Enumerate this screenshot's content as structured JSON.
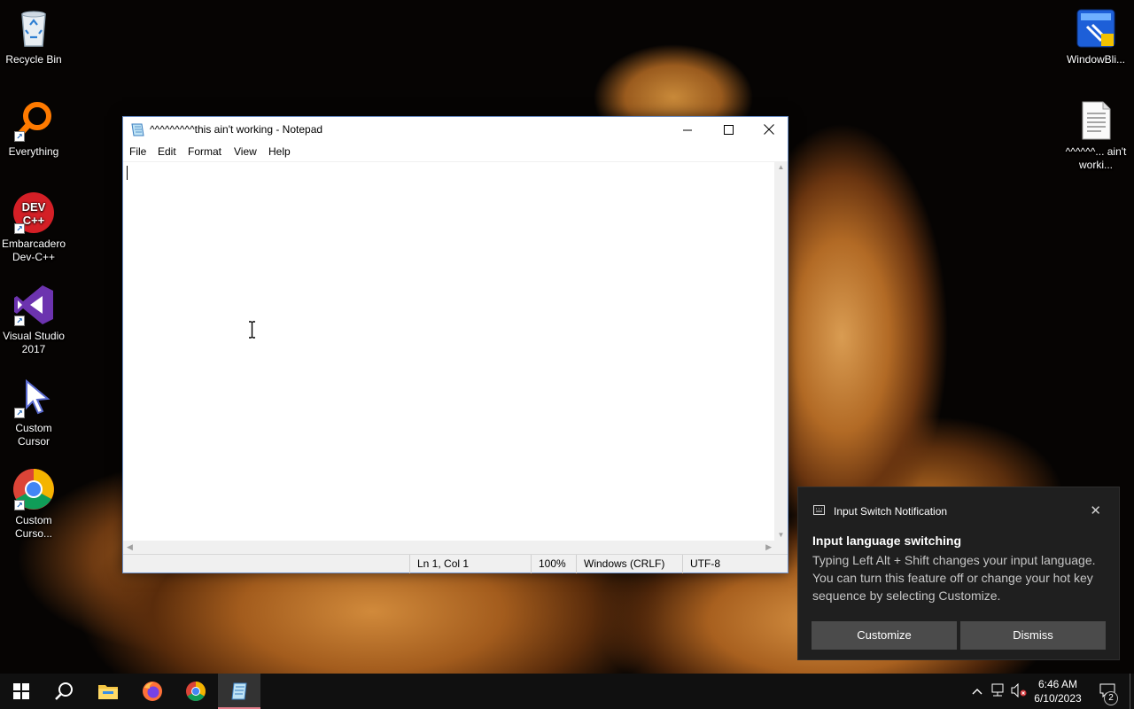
{
  "desktop": {
    "icons_left": [
      {
        "id": "recycle-bin",
        "label": "Recycle Bin"
      },
      {
        "id": "everything",
        "label": "Everything"
      },
      {
        "id": "dev-cpp",
        "label": "Embarcadero Dev-C++",
        "logo_text": "DEV C++"
      },
      {
        "id": "visual-studio",
        "label": "Visual Studio 2017"
      },
      {
        "id": "custom-cursor",
        "label": "Custom Cursor"
      },
      {
        "id": "custom-curso-chrome",
        "label": "Custom Curso..."
      }
    ],
    "icons_right": [
      {
        "id": "windowblinds",
        "label": "WindowBli..."
      },
      {
        "id": "text-file",
        "label": "^^^^^^... ain't worki..."
      }
    ]
  },
  "notepad": {
    "title": "^^^^^^^^^this ain't working - Notepad",
    "menu": [
      "File",
      "Edit",
      "Format",
      "View",
      "Help"
    ],
    "content": "",
    "status": {
      "position": "Ln 1, Col 1",
      "zoom": "100%",
      "line_ending": "Windows (CRLF)",
      "encoding": "UTF-8"
    }
  },
  "toast": {
    "app_name": "Input Switch Notification",
    "heading": "Input language switching",
    "body": "Typing Left Alt + Shift changes your input language. You can turn this feature off or change your hot key sequence by selecting Customize.",
    "buttons": [
      "Customize",
      "Dismiss"
    ]
  },
  "taskbar": {
    "pinned": [
      "start-icon",
      "search-icon",
      "file-explorer-icon",
      "firefox-icon",
      "chrome-icon",
      "notepad-icon"
    ],
    "active": "notepad-icon",
    "clock_time": "6:46 AM",
    "clock_date": "6/10/2023",
    "notification_count": "2"
  },
  "colors": {
    "taskbar": "#101010",
    "toast_bg": "#1f1f1f",
    "toast_button": "#4b4b4b",
    "active_task_indicator": "#e27d8a"
  }
}
